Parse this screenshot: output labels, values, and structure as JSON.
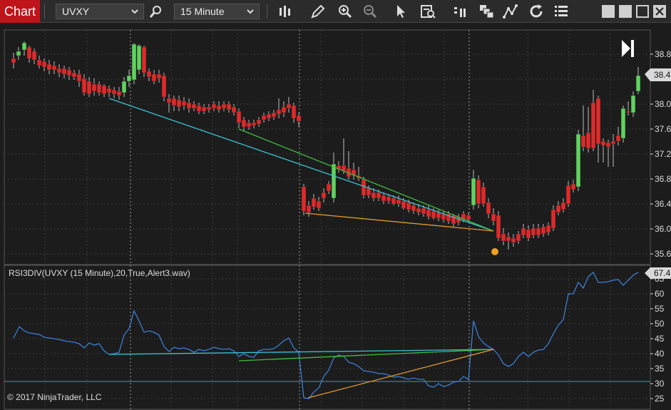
{
  "toolbar": {
    "tab_label": "Chart",
    "instrument": "UVXY",
    "interval": "15 Minute",
    "icons": [
      "search-icon",
      "bars-icon",
      "pencil-icon",
      "zoom-in-icon",
      "zoom-out-icon",
      "pointer-icon",
      "data-box-icon",
      "chart-style-icon",
      "order-icon",
      "strategy-icon",
      "refresh-icon",
      "properties-icon"
    ]
  },
  "price_panel": {
    "axis_labels": [
      "38.8",
      "38.4",
      "38.0",
      "37.6",
      "37.2",
      "36.8",
      "36.4",
      "36.0",
      "35.6"
    ],
    "last_price": "38.4"
  },
  "indicator_panel": {
    "label": "RSI3DIV(UVXY (15 Minute),20,True,Alert3.wav)",
    "axis_labels": [
      "65",
      "60",
      "55",
      "50",
      "45",
      "40",
      "35",
      "30",
      "25"
    ],
    "last_value": "67.4",
    "line_color": "#3a7fd5"
  },
  "copyright": "© 2017 NinjaTrader, LLC",
  "colors": {
    "up": "#5fd35f",
    "down": "#e02a2a",
    "accent": "#c0141b"
  }
}
